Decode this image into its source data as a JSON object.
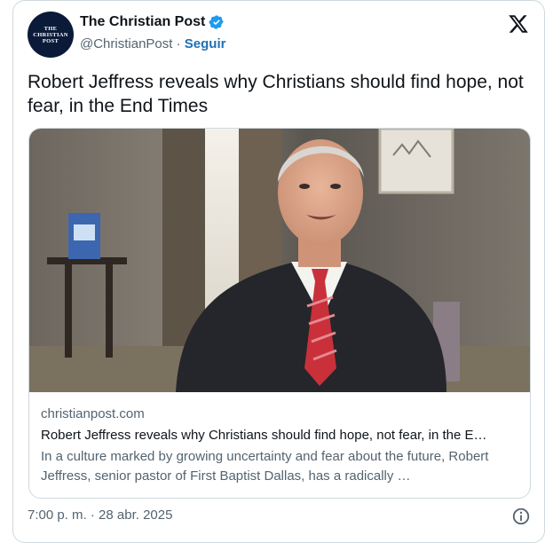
{
  "author": {
    "avatar_text": [
      "THE",
      "CHRISTIAN",
      "POST"
    ],
    "display_name": "The Christian Post",
    "handle": "@ChristianPost",
    "separator": "·",
    "follow_label": "Seguir",
    "verified_icon": "verified-badge-icon",
    "brand_icon": "x-logo-icon"
  },
  "tweet": {
    "text": "Robert Jeffress reveals why Christians should find hope, not fear, in the End Times"
  },
  "link_card": {
    "image_description_icon": "article-photo",
    "domain": "christianpost.com",
    "title": "Robert Jeffress reveals why Christians should find hope, not fear, in the E…",
    "description": "In a culture marked by growing uncertainty and fear about the future, Robert Jeffress, senior pastor of First Baptist Dallas, has a radically …"
  },
  "footer": {
    "timestamp": "7:00 p. m. · 28 abr. 2025",
    "info_icon": "info-icon"
  },
  "colors": {
    "accent": "#1d9bf0",
    "link": "#1d70b8",
    "secondary_text": "#536471",
    "border": "#cfd9de"
  }
}
